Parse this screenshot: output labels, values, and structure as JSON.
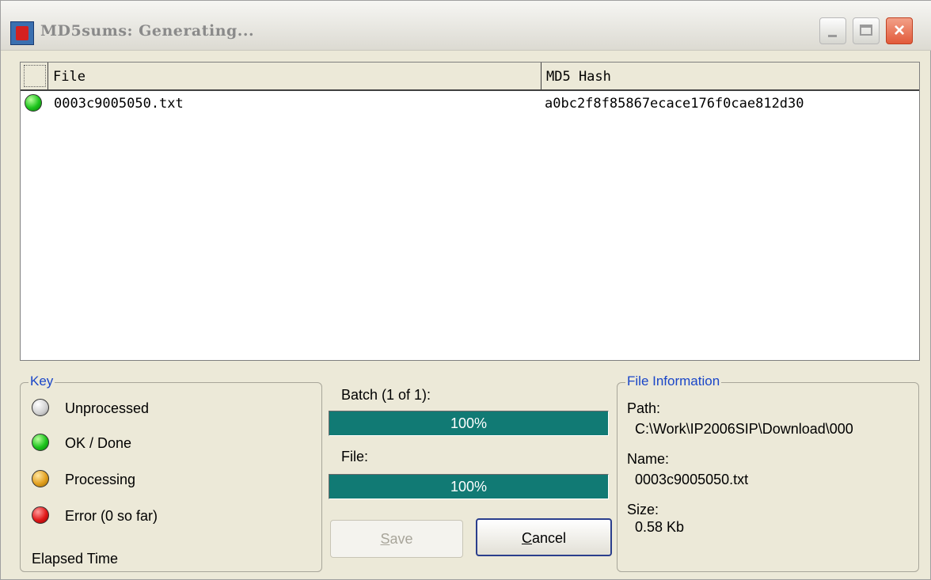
{
  "window": {
    "title": "MD5sums: Generating...",
    "controls": {
      "minimize": "minimize",
      "maximize": "maximize",
      "close": "×"
    }
  },
  "list": {
    "columns": [
      "File",
      "MD5 Hash"
    ],
    "rows": [
      {
        "status": "ok-done",
        "file": "0003c9005050.txt",
        "hash": "a0bc2f8f85867ecace176f0cae812d30"
      }
    ]
  },
  "key": {
    "title": "Key",
    "items": [
      {
        "label": "Unprocessed",
        "color": "#cfcfcf"
      },
      {
        "label": "OK / Done",
        "color": "#1cc41c"
      },
      {
        "label": "Processing",
        "color": "#e2a020"
      },
      {
        "label": "Error (0 so far)",
        "color": "#e01818"
      }
    ],
    "elapsed_label": "Elapsed Time"
  },
  "progress": {
    "batch_label": "Batch (1 of 1):",
    "batch_percent": 100,
    "batch_text": "100%",
    "file_label": "File:",
    "file_percent": 100,
    "file_text": "100%",
    "bar_color": "#117a74"
  },
  "buttons": {
    "save_prefix": "S",
    "save_rest": "ave",
    "cancel_prefix": "C",
    "cancel_rest": "ancel"
  },
  "file_info": {
    "title": "File Information",
    "path_label": "Path:",
    "path_value": "C:\\Work\\IP2006SIP\\Download\\000",
    "name_label": "Name:",
    "name_value": "0003c9005050.txt",
    "size_label": "Size:",
    "size_value": "0.58 Kb"
  }
}
